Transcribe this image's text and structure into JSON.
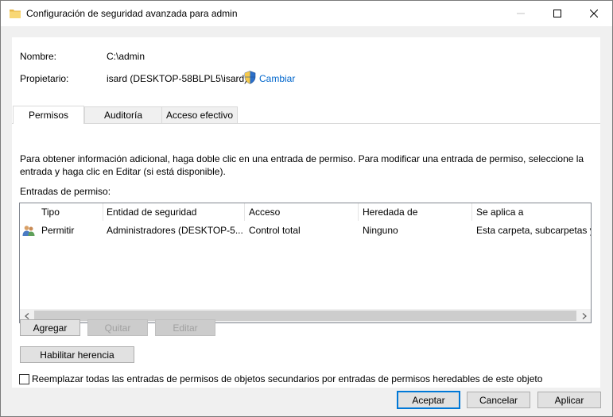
{
  "window": {
    "title": "Configuración de seguridad avanzada para admin"
  },
  "info": {
    "name_label": "Nombre:",
    "name_value": "C:\\admin",
    "owner_label": "Propietario:",
    "owner_value": "isard (DESKTOP-58BLPL5\\isard)",
    "change_link": "Cambiar"
  },
  "tabs": [
    {
      "label": "Permisos",
      "active": true
    },
    {
      "label": "Auditoría",
      "active": false
    },
    {
      "label": "Acceso efectivo",
      "active": false
    }
  ],
  "permissions": {
    "description_line1": "Para obtener información adicional, haga doble clic en una entrada de permiso. Para modificar una entrada de permiso, seleccione la",
    "description_line2": "entrada y haga clic en Editar (si está disponible).",
    "entries_label": "Entradas de permiso:",
    "columns": [
      "Tipo",
      "Entidad de seguridad",
      "Acceso",
      "Heredada de",
      "Se aplica a"
    ],
    "rows": [
      {
        "icon": "users-icon",
        "tipo": "Permitir",
        "entidad": "Administradores (DESKTOP-5...",
        "acceso": "Control total",
        "heredada": "Ninguno",
        "aplica": "Esta carpeta, subcarpetas y ..."
      }
    ],
    "add_button": "Agregar",
    "remove_button": "Quitar",
    "edit_button": "Editar",
    "inheritance_button": "Habilitar herencia",
    "replace_checkbox_label": "Reemplazar todas las entradas de permisos de objetos secundarios por entradas de permisos heredables de este objeto",
    "replace_checked": false
  },
  "footer": {
    "ok": "Aceptar",
    "cancel": "Cancelar",
    "apply": "Aplicar"
  },
  "colors": {
    "accent": "#0078d7",
    "link": "#0066cc"
  }
}
